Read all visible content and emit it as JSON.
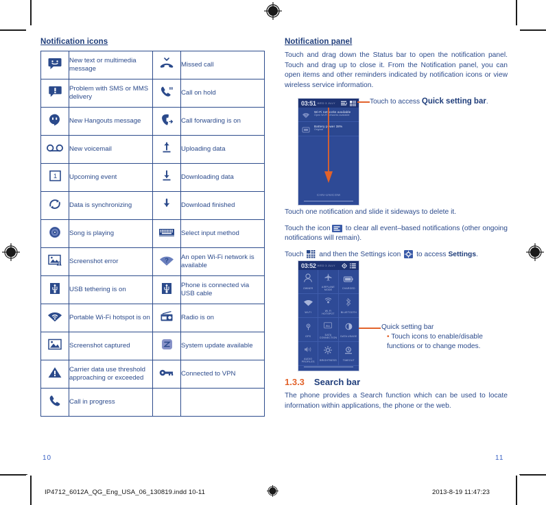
{
  "document": {
    "left_page_number": "10",
    "right_page_number": "11",
    "footer_file": "IP4712_6012A_QG_Eng_USA_06_130819.indd   10-11",
    "footer_date": "2013-8-19   11:47:23"
  },
  "left": {
    "heading": "Notification icons",
    "rows": [
      {
        "icon_a": "message-icon",
        "label_a": "New text or multimedia message",
        "icon_b": "missed-call-icon",
        "label_b": "Missed call"
      },
      {
        "icon_a": "message-alert-icon",
        "label_a": "Problem with SMS or MMS delivery",
        "icon_b": "call-hold-icon",
        "label_b": "Call on hold"
      },
      {
        "icon_a": "hangouts-icon",
        "label_a": "New Hangouts message",
        "icon_b": "call-forward-icon",
        "label_b": "Call forwarding is on"
      },
      {
        "icon_a": "voicemail-icon",
        "label_a": "New voicemail",
        "icon_b": "upload-icon",
        "label_b": "Uploading data"
      },
      {
        "icon_a": "calendar-event-icon",
        "label_a": "Upcoming event",
        "icon_b": "download-icon",
        "label_b": "Downloading data"
      },
      {
        "icon_a": "sync-icon",
        "label_a": "Data is synchronizing",
        "icon_b": "download-done-icon",
        "label_b": "Download finished"
      },
      {
        "icon_a": "music-disc-icon",
        "label_a": "Song is playing",
        "icon_b": "keyboard-icon",
        "label_b": "Select input method"
      },
      {
        "icon_a": "screenshot-error-icon",
        "label_a": "Screenshot error",
        "icon_b": "wifi-open-icon",
        "label_b": "An open Wi-Fi network is available"
      },
      {
        "icon_a": "usb-tether-icon",
        "label_a": "USB tethering is on",
        "icon_b": "usb-icon",
        "label_b": "Phone is connected via USB cable"
      },
      {
        "icon_a": "wifi-hotspot-icon",
        "label_a": "Portable Wi-Fi hotspot is on",
        "icon_b": "radio-icon",
        "label_b": "Radio is on"
      },
      {
        "icon_a": "screenshot-icon",
        "label_a": "Screenshot captured",
        "icon_b": "system-update-icon",
        "label_b": "System update available"
      },
      {
        "icon_a": "warning-icon",
        "label_a": "Carrier data use threshold approaching or exceeded",
        "icon_b": "vpn-key-icon",
        "label_b": "Connected to VPN"
      },
      {
        "icon_a": "call-active-icon",
        "label_a": "Call in progress",
        "icon_b": "",
        "label_b": ""
      }
    ]
  },
  "right": {
    "heading": "Notification panel",
    "intro": "Touch and drag down the Status bar to open the notification panel. Touch and drag up to close it. From the Notification panel, you can open items and other reminders indicated by notification icons or view wireless service information.",
    "callout_quick_setting": {
      "prefix": "Touch to access ",
      "bold": "Quick setting bar",
      "suffix": "."
    },
    "para_delete": "Touch one notification and slide it sideways to delete it.",
    "para_clear_1": "Touch the icon",
    "para_clear_2": "to clear all event–based notifications (other ongoing notifications will remain).",
    "para_settings_1": "Touch",
    "para_settings_2": "and then the Settings icon",
    "para_settings_3": "to access",
    "para_settings_bold": "Settings",
    "para_settings_end": ".",
    "callout_qsbar": {
      "title": "Quick setting bar",
      "bullet": "Touch icons to enable/disable functions or to change modes."
    },
    "section": {
      "number": "1.3.3",
      "title": "Search bar",
      "body": "The phone provides a Search function which can be used to locate information within applications, the phone or the web."
    }
  },
  "phone_notification": {
    "clock": "03:51",
    "carrier_blur": "WED 3 JULY",
    "notifications": [
      {
        "title": "Wi-Fi networks available",
        "sub": "Open Wi-Fi networks available",
        "icon": "wifi-question-icon"
      },
      {
        "title": "Battery power 38%",
        "sub": "Original",
        "icon": "battery-icon"
      }
    ],
    "bottom_label": "CHN-UNICOM"
  },
  "phone_quicksettings": {
    "clock": "03:52",
    "carrier_blur": "WED 3 JULY",
    "tiles": [
      {
        "label": "OWNER",
        "icon": "user-icon"
      },
      {
        "label": "AIRPLANE MODE",
        "icon": "airplane-icon"
      },
      {
        "label": "CHARGED",
        "icon": "battery-full-icon"
      },
      {
        "label": "WI-FI",
        "icon": "wifi-icon"
      },
      {
        "label": "WI-FI HOTSPOT",
        "icon": "hotspot-icon"
      },
      {
        "label": "BLUETOOTH",
        "icon": "bluetooth-icon"
      },
      {
        "label": "GPS",
        "icon": "gps-icon"
      },
      {
        "label": "DATA CONNECTION",
        "icon": "data-icon"
      },
      {
        "label": "DATA USAGE",
        "icon": "usage-icon"
      },
      {
        "label": "AUDIO PROFILES",
        "icon": "volume-icon"
      },
      {
        "label": "BRIGHTNESS",
        "icon": "brightness-icon"
      },
      {
        "label": "TIMEOUT",
        "icon": "timeout-icon"
      }
    ]
  },
  "colors": {
    "brand_blue": "#2b4a8b",
    "dark_blue": "#1f3d7a",
    "accent_orange": "#e2622a",
    "phone_bg": "#2e4a96",
    "page_number_blue": "#3a62c4"
  }
}
